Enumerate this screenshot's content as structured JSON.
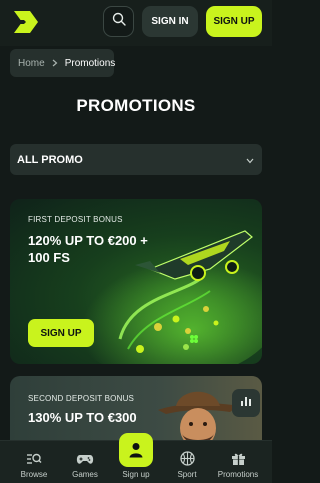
{
  "colors": {
    "accent": "#c9f31d",
    "background": "#131a18",
    "surface": "#26302d"
  },
  "header": {
    "logo_icon": "arrow-logo-icon",
    "search_icon": "search-icon",
    "signin_label": "SIGN IN",
    "signup_label": "SIGN UP"
  },
  "breadcrumb": {
    "items": [
      {
        "label": "Home"
      },
      {
        "label": "Promotions"
      }
    ],
    "separator_icon": "chevron-right-icon"
  },
  "page": {
    "title": "PROMOTIONS"
  },
  "filter": {
    "selected": "ALL PROMO",
    "icon": "chevron-down-icon"
  },
  "promos": [
    {
      "eyebrow": "FIRST DEPOSIT BONUS",
      "title_line1": "120% UP TO €200 +",
      "title_line2": "100 FS",
      "cta": "SIGN UP",
      "art": "green-spaceship-coins"
    },
    {
      "eyebrow": "SECOND DEPOSIT BONUS",
      "title_line1": "130% UP TO €300",
      "art": "cowboy-character"
    }
  ],
  "floating": {
    "stats_icon": "bar-chart-icon"
  },
  "bottom_nav": {
    "items": [
      {
        "label": "Browse",
        "icon": "browse-icon"
      },
      {
        "label": "Games",
        "icon": "gamepad-icon"
      },
      {
        "label": "Sign up",
        "icon": "user-icon"
      },
      {
        "label": "Sport",
        "icon": "basketball-icon"
      },
      {
        "label": "Promotions",
        "icon": "gift-icon"
      }
    ]
  }
}
